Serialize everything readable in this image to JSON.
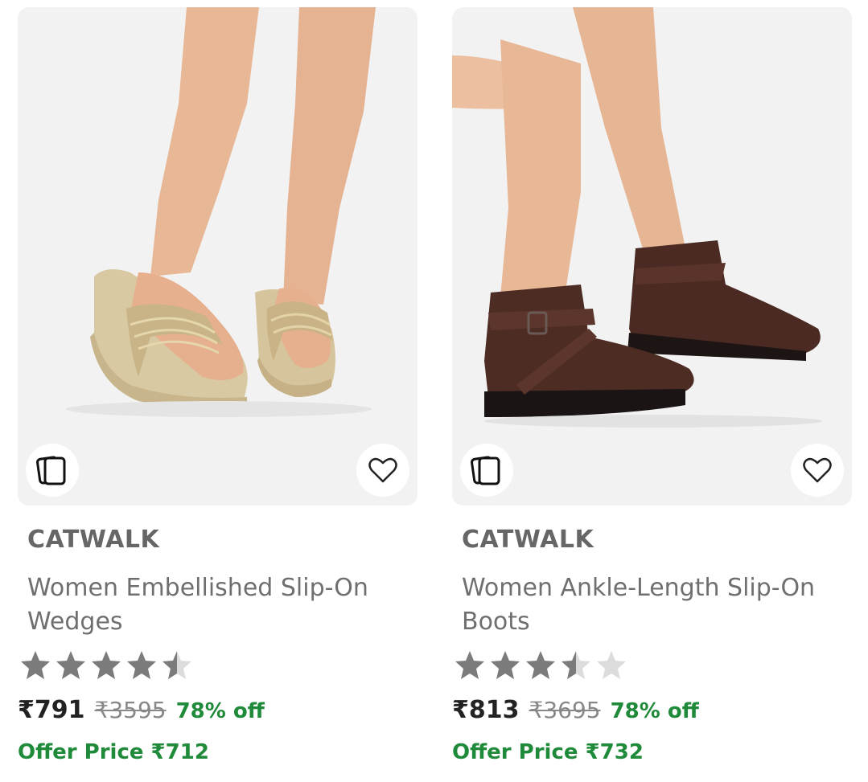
{
  "colors": {
    "brand_text": "#666666",
    "title_text": "#6f6f6f",
    "price_text": "#222222",
    "mrp_text": "#888888",
    "discount_green": "#1f8a3a",
    "star_filled": "#7b7b7b",
    "star_empty": "#dcdcdc",
    "image_bg": "#f2f2f2"
  },
  "products": [
    {
      "image_icon": "gold-wedge-sandals-photo",
      "similar_icon": "similar-products-icon",
      "wishlist_icon": "heart-icon",
      "brand": "CATWALK",
      "title": "Women Embellished Slip-On Wedges",
      "rating": 4.5,
      "price": "₹791",
      "mrp": "₹3595",
      "discount": "78% off",
      "offer_price": "Offer Price ₹712"
    },
    {
      "image_icon": "brown-ankle-boots-photo",
      "similar_icon": "similar-products-icon",
      "wishlist_icon": "heart-icon",
      "brand": "CATWALK",
      "title": "Women Ankle-Length Slip-On Boots",
      "rating": 3.5,
      "price": "₹813",
      "mrp": "₹3695",
      "discount": "78% off",
      "offer_price": "Offer Price ₹732"
    }
  ]
}
